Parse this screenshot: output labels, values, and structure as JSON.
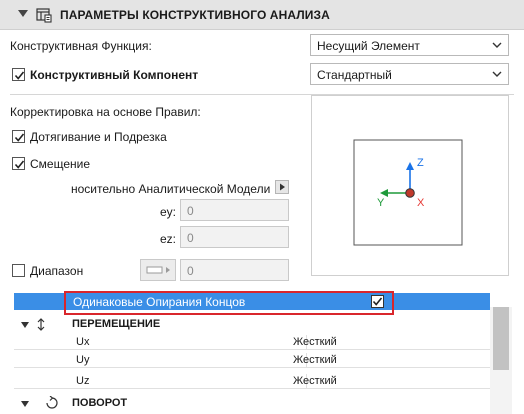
{
  "header": {
    "title": "ПАРАМЕТРЫ КОНСТРУКТИВНОГО АНАЛИЗА"
  },
  "structural_function": {
    "label": "Конструктивная Функция:",
    "value": "Несущий Элемент"
  },
  "structural_component": {
    "label": "Конструктивный Компонент",
    "value": "Стандартный",
    "checked": true
  },
  "rules": {
    "label": "Корректировка на основе Правил:",
    "extend_trim": {
      "label": "Дотягивание и Подрезка",
      "checked": true
    },
    "offset": {
      "label": "Смещение",
      "checked": true
    },
    "relative_label": "носительно Аналитической Модели",
    "ey": {
      "label": "ey:",
      "value": "0"
    },
    "ez": {
      "label": "ez:",
      "value": "0"
    },
    "range": {
      "label": "Диапазон",
      "checked": false,
      "value": "0"
    }
  },
  "preview": {
    "z_label": "Z",
    "y_label": "Y",
    "x_label": "X"
  },
  "table": {
    "selected_row": {
      "label": "Одинаковые Опирания Концов",
      "checked": true
    },
    "section_move": "ПЕРЕМЕЩЕНИЕ",
    "rows": [
      {
        "name": "Ux",
        "value": "Жесткий"
      },
      {
        "name": "Uy",
        "value": "Жесткий"
      },
      {
        "name": "Uz",
        "value": "Жесткий"
      }
    ],
    "section_rotate": "ПОВОРОТ"
  },
  "colors": {
    "selection": "#3a8ee6",
    "highlight_border": "#d9262c",
    "z_axis": "#1a73e8",
    "y_axis": "#1e9a3a",
    "x_axis": "#e53935"
  }
}
